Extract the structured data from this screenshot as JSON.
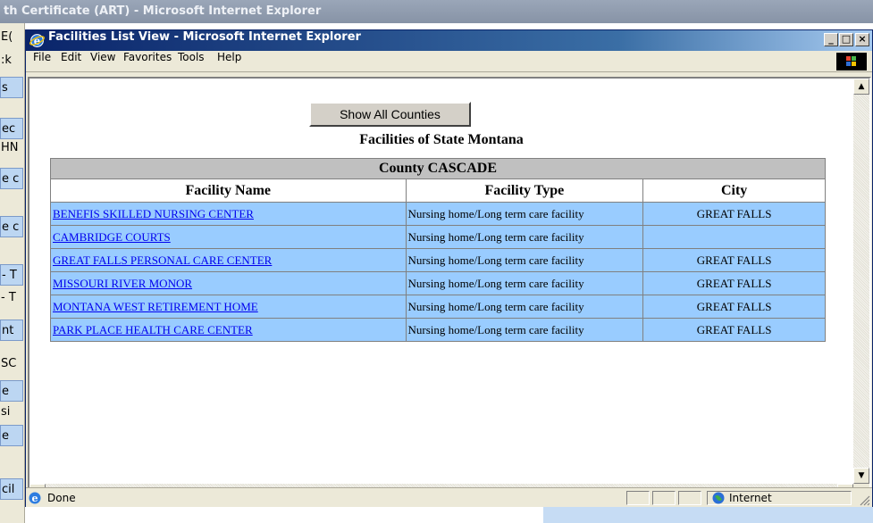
{
  "background_window": {
    "title": "th Certificate (ART) - Microsoft Internet Explorer",
    "side_fragments": [
      "E(",
      ":k",
      "s",
      "ec",
      "HN",
      "e c",
      "e c",
      "- T",
      "- T",
      "nt",
      "SC",
      "e",
      "si",
      "e",
      "cil"
    ]
  },
  "window": {
    "title": "Facilities List View - Microsoft Internet Explorer",
    "buttons": {
      "minimize": "_",
      "maximize": "□",
      "close": "×"
    }
  },
  "menu": [
    "File",
    "Edit",
    "View",
    "Favorites",
    "Tools",
    "Help"
  ],
  "page": {
    "show_all_button": "Show All Counties",
    "title": "Facilities of State Montana",
    "county_header": "County CASCADE",
    "columns": [
      "Facility Name",
      "Facility Type",
      "City"
    ],
    "rows": [
      {
        "name": "BENEFIS SKILLED NURSING CENTER",
        "type": "Nursing home/Long term care facility",
        "city": "GREAT FALLS"
      },
      {
        "name": "CAMBRIDGE COURTS",
        "type": "Nursing home/Long term care facility",
        "city": ""
      },
      {
        "name": "GREAT FALLS PERSONAL CARE CENTER",
        "type": "Nursing home/Long term care facility",
        "city": "GREAT FALLS"
      },
      {
        "name": "MISSOURI RIVER MONOR",
        "type": "Nursing home/Long term care facility",
        "city": "GREAT FALLS"
      },
      {
        "name": "MONTANA WEST RETIREMENT HOME",
        "type": "Nursing home/Long term care facility",
        "city": "GREAT FALLS"
      },
      {
        "name": "PARK PLACE HEALTH CARE CENTER",
        "type": "Nursing home/Long term care facility",
        "city": "GREAT FALLS"
      }
    ]
  },
  "status": {
    "text": "Done",
    "zone": "Internet"
  },
  "colors": {
    "row_background": "#99ccff",
    "county_header_background": "#c0c0c0",
    "link": "#0000ee",
    "titlebar": "#0a246a"
  },
  "icons": [
    "ie-icon",
    "windows-logo-icon",
    "globe-icon",
    "resize-grip-icon"
  ]
}
